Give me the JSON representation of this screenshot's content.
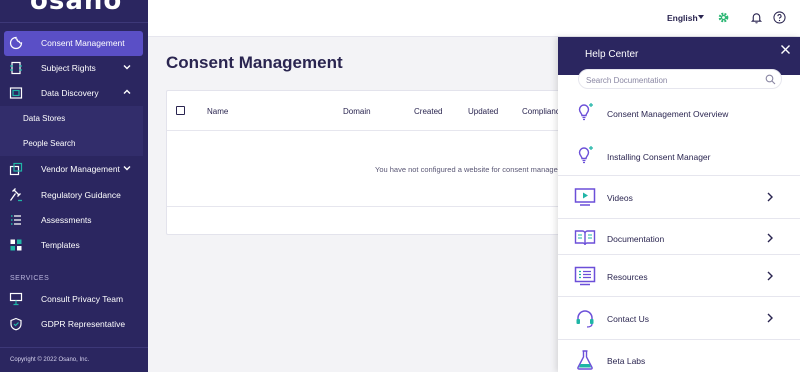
{
  "brand": {
    "logo_text": "osano"
  },
  "sidebar": {
    "items": [
      {
        "label": "Consent Management",
        "icon": "consent-icon",
        "active": true
      },
      {
        "label": "Subject Rights",
        "icon": "subject-rights-icon",
        "chevron": "down"
      },
      {
        "label": "Data Discovery",
        "icon": "data-discovery-icon",
        "chevron": "up"
      },
      {
        "label": "Data Stores",
        "sub": true
      },
      {
        "label": "People Search",
        "sub": true
      },
      {
        "label": "Vendor Management",
        "icon": "vendor-icon",
        "chevron": "down"
      },
      {
        "label": "Regulatory Guidance",
        "icon": "gavel-icon"
      },
      {
        "label": "Assessments",
        "icon": "list-icon"
      },
      {
        "label": "Templates",
        "icon": "templates-icon"
      }
    ],
    "services_label": "SERVICES",
    "services": [
      {
        "label": "Consult Privacy Team",
        "icon": "presentation-icon"
      },
      {
        "label": "GDPR Representative",
        "icon": "shield-icon"
      }
    ],
    "copyright": "Copyright © 2022 Osano, Inc."
  },
  "topbar": {
    "language": "English",
    "icons": [
      "settings-gear-icon",
      "bell-icon",
      "help-icon"
    ]
  },
  "main": {
    "title": "Consent Management",
    "table": {
      "columns": [
        "Name",
        "Domain",
        "Created",
        "Updated",
        "Complianc"
      ],
      "empty_message": "You have not configured a website for consent manager"
    }
  },
  "help_panel": {
    "title": "Help Center",
    "search_placeholder": "Search Documentation",
    "items": [
      {
        "label": "Consent Management Overview",
        "icon": "lightbulb-icon",
        "chevron": false
      },
      {
        "label": "Installing Consent Manager",
        "icon": "lightbulb-icon",
        "chevron": false
      },
      {
        "label": "Videos",
        "icon": "video-icon",
        "chevron": true
      },
      {
        "label": "Documentation",
        "icon": "book-icon",
        "chevron": true
      },
      {
        "label": "Resources",
        "icon": "resources-icon",
        "chevron": true
      },
      {
        "label": "Contact Us",
        "icon": "headset-icon",
        "chevron": true
      },
      {
        "label": "Beta Labs",
        "icon": "flask-icon",
        "chevron": false
      }
    ]
  },
  "colors": {
    "sidebar_bg": "#2b2660",
    "active_item": "#5a4fc6",
    "accent_purple": "#6b4fd8",
    "accent_teal": "#1fb5a6",
    "gear_green": "#2bb673"
  }
}
